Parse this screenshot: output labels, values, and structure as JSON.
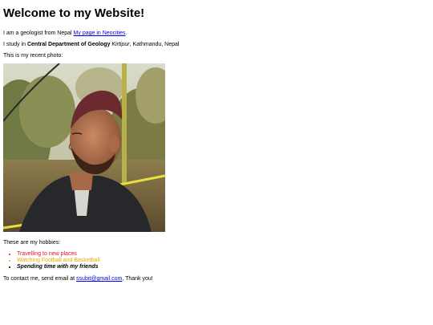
{
  "page": {
    "heading": "Welcome to my Website!",
    "intro": {
      "text": "I am a geologist from Nepal ",
      "link_label": "My page in Neocities",
      "suffix": "."
    },
    "study": {
      "prefix": "I study in ",
      "department": "Central Department of Geology",
      "sep1": " ",
      "place": "Kirtipur",
      "suffix": ", Kathmandu, Nepal"
    },
    "photo_caption": "This is my recent photo:",
    "hobbies_intro": "These are my hobbies:",
    "hobbies": [
      {
        "label": "Travelling to new places",
        "color": "#e0141b"
      },
      {
        "label": "Watching Football and Basketball",
        "color": "#f0a800"
      },
      {
        "label": "Spending time with my friends",
        "color": "#000000"
      }
    ],
    "contact": {
      "prefix": "To contact me, send email at ",
      "email": "ssubit@gmail.com",
      "suffix": ", Thank you!"
    }
  }
}
